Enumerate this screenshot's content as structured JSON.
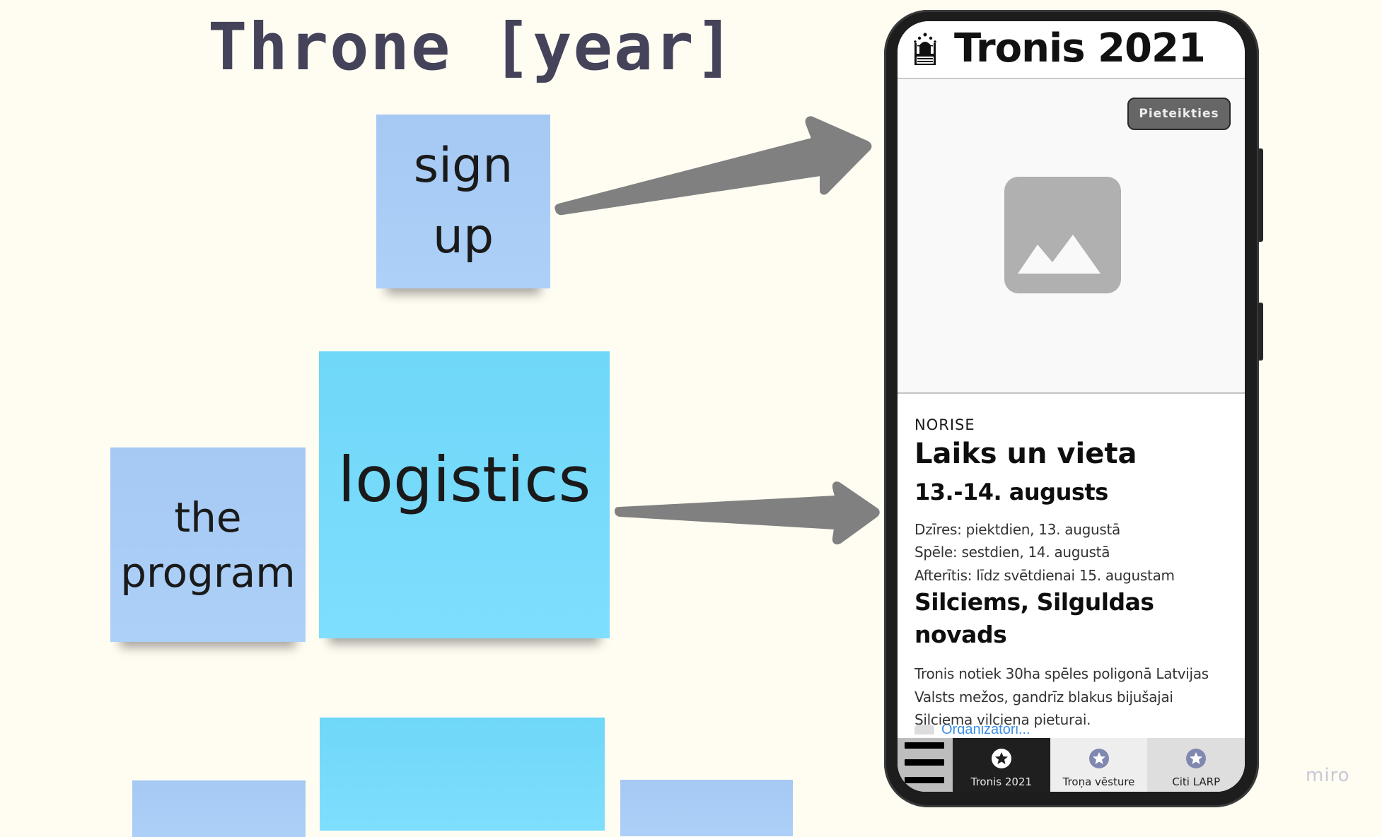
{
  "board": {
    "title": "Throne [year]",
    "watermark": "miro"
  },
  "stickies": {
    "signup": {
      "lines": [
        "sign",
        "up"
      ],
      "color": "#a8cbf5"
    },
    "program": {
      "lines": [
        "the",
        "program"
      ],
      "color": "#a8cbf5"
    },
    "logistics": {
      "lines": [
        "logistics"
      ],
      "color": "#72d8f8"
    },
    "bottom_row": [
      {
        "color": "#a8cbf5",
        "text": ""
      },
      {
        "color": "#72d8f8",
        "text": ""
      },
      {
        "color": "#a8cbf5",
        "text": ""
      }
    ]
  },
  "arrows": {
    "color": "#808080",
    "connections": [
      {
        "from": "sign up",
        "to": "Pieteikties button"
      },
      {
        "from": "logistics",
        "to": "Laiks un vieta section"
      }
    ]
  },
  "phone": {
    "header": {
      "icon": "throne-icon",
      "title": "Tronis 2021"
    },
    "hero": {
      "signup_button": "Pieteikties",
      "image_icon": "image-placeholder-icon"
    },
    "section": {
      "overline": "NORISE",
      "title": "Laiks un vieta",
      "date": "13.-14. augusts",
      "details": [
        "Dzīres: piektdien, 13. augustā",
        "Spēle: sestdien, 14. augustā",
        "Afterītis: līdz svētdienai 15. augustam"
      ],
      "location_line1": "Silciems, Silguldas",
      "location_line2": "novads",
      "description": "Tronis notiek 30ha spēles poligonā Latvijas Valsts mežos, gandrīz blakus bijušajai Silciema vilciena pieturai.",
      "partial_link": "Organizatori..."
    },
    "bottom_nav": {
      "menu_icon": "hamburger-menu-icon",
      "tabs": [
        {
          "label": "Tronis 2021",
          "icon": "star-icon",
          "active": true
        },
        {
          "label": "Troņa vēsture",
          "icon": "star-icon",
          "active": false
        },
        {
          "label": "Citi LARP",
          "icon": "star-icon",
          "active": false
        }
      ],
      "colors": {
        "active_bg": "#1f1f1f",
        "inactive_icon": "#8088b0"
      }
    }
  }
}
